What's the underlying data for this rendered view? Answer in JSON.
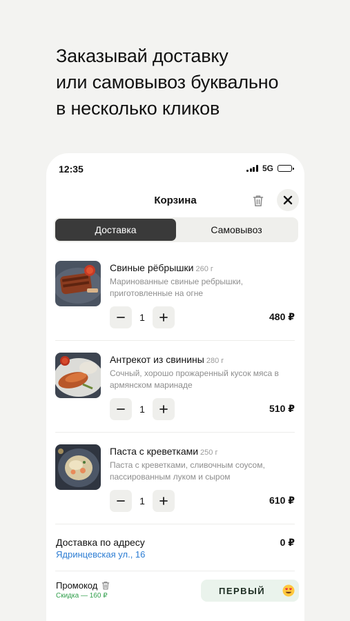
{
  "headline": {
    "line1": "Заказывай доставку",
    "line2": "или самовывоз буквально",
    "line3": "в несколько кликов"
  },
  "status_bar": {
    "time": "12:35",
    "network": "5G"
  },
  "cart": {
    "title": "Корзина",
    "tabs": [
      {
        "label": "Доставка",
        "active": true
      },
      {
        "label": "Самовывоз",
        "active": false
      }
    ],
    "items": [
      {
        "name": "Свиные рёбрышки",
        "weight": "260 г",
        "description": "Маринованные свиные ребрышки, приготовленные на огне",
        "quantity": "1",
        "price": "480 ₽"
      },
      {
        "name": "Антрекот из свинины",
        "weight": "280 г",
        "description": "Сочный, хорошо прожаренный кусок мяса в армянском маринаде",
        "quantity": "1",
        "price": "510 ₽"
      },
      {
        "name": "Паста с креветками",
        "weight": "250 г",
        "description": "Паста с креветками, сливочным соусом, пассированным луком и сыром",
        "quantity": "1",
        "price": "610 ₽"
      }
    ],
    "delivery": {
      "label": "Доставка по адресу",
      "address": "Ядринцевская ул., 16",
      "price": "0 ₽"
    },
    "promo": {
      "label": "Промокод",
      "discount": "Скидка — 160 ₽",
      "code": "ПЕРВЫЙ"
    }
  },
  "colors": {
    "background": "#f3f3f1",
    "active_tab": "#3a3a3a",
    "link": "#2b7cd3",
    "discount": "#2f9e4a",
    "promo_pill": "#eaf3ec"
  },
  "icons": [
    "signal-icon",
    "battery-icon",
    "trash-icon",
    "close-icon",
    "minus-icon",
    "plus-icon",
    "smiling-face-with-heart-eyes-emoji"
  ]
}
